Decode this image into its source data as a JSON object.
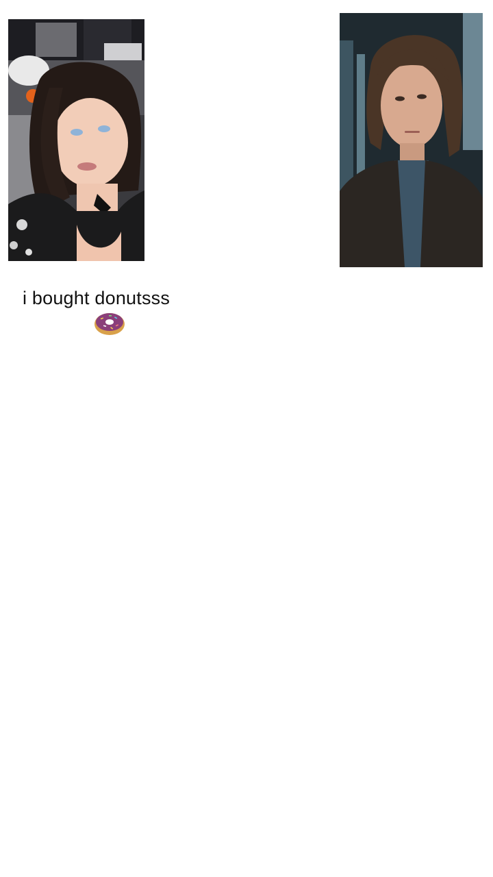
{
  "caption": {
    "text": "i bought donutsss",
    "emoji_icon": "donut-icon"
  },
  "media": {
    "left_photo": "selfie-photo",
    "right_photo": "portrait-photo"
  },
  "colors": {
    "background": "#ffffff",
    "caption_text": "#111111",
    "donut_dough": "#d9a14a",
    "donut_icing": "#8a3f7a"
  }
}
